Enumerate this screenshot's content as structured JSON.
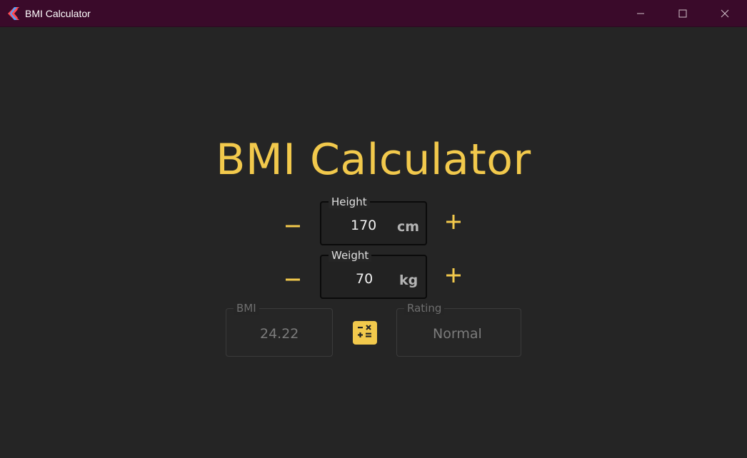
{
  "window": {
    "title": "BMI Calculator",
    "accent_color": "#f2c94c",
    "titlebar_color": "#3a0a2a",
    "background_color": "#252525",
    "controls": [
      "minimize-icon",
      "maximize-icon",
      "close-icon"
    ]
  },
  "main": {
    "heading": "BMI Calculator"
  },
  "height": {
    "label": "Height",
    "value": "170",
    "unit": "cm",
    "decrement_icon": "minus-icon",
    "increment_icon": "plus-icon"
  },
  "weight": {
    "label": "Weight",
    "value": "70",
    "unit": "kg",
    "decrement_icon": "minus-icon",
    "increment_icon": "plus-icon"
  },
  "result": {
    "bmi_label": "BMI",
    "bmi_value": "24.22",
    "calculate_icon": "calculator-icon",
    "rating_label": "Rating",
    "rating_value": "Normal"
  }
}
